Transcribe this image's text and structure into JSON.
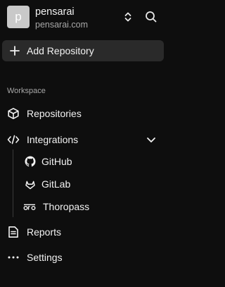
{
  "org": {
    "avatar_letter": "p",
    "name": "pensarai",
    "domain": "pensarai.com"
  },
  "header_icons": {
    "switch": "chevrons-up-down-icon",
    "search": "search-icon"
  },
  "add_repo": {
    "label": "Add Repository",
    "icon": "plus-icon"
  },
  "workspace": {
    "section_label": "Workspace",
    "items": [
      {
        "label": "Repositories",
        "icon": "box-icon"
      },
      {
        "label": "Integrations",
        "icon": "code-icon",
        "expanded": true,
        "children": [
          {
            "label": "GitHub",
            "icon": "github-icon"
          },
          {
            "label": "GitLab",
            "icon": "gitlab-icon"
          },
          {
            "label": "Thoropass",
            "icon": "thoropass-icon"
          }
        ]
      },
      {
        "label": "Reports",
        "icon": "file-text-icon"
      },
      {
        "label": "Settings",
        "icon": "more-horizontal-icon"
      }
    ]
  },
  "colors": {
    "background": "#0e0e0e",
    "button_bg": "#2a2a2a",
    "text": "#f2f2f2",
    "muted_text": "#a8a8a8",
    "avatar_bg": "#c9c9c9"
  }
}
